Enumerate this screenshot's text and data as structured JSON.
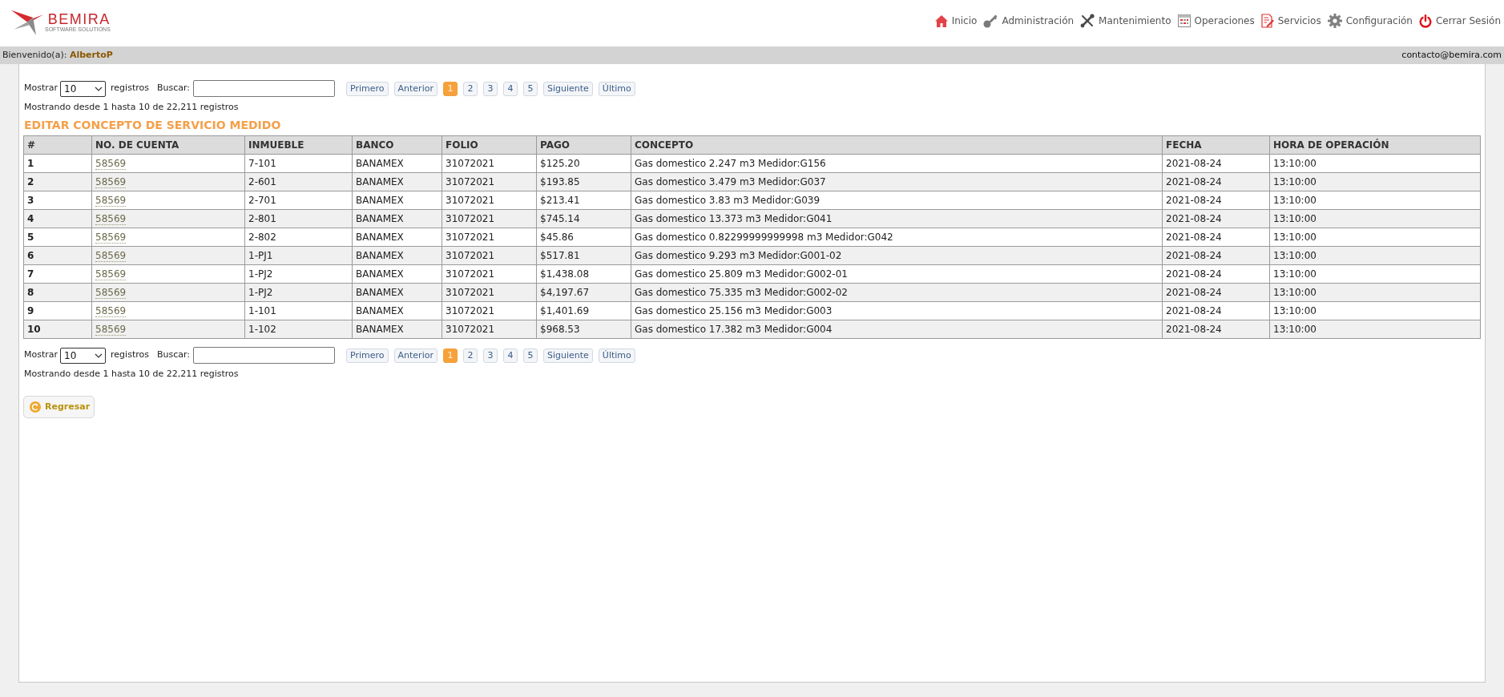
{
  "header": {
    "logo": {
      "brand": "BEMIRA",
      "tagline": "SOFTWARE SOLUTIONS"
    },
    "nav": [
      "Inicio",
      "Administración",
      "Mantenimiento",
      "Operaciones",
      "Servicios",
      "Configuración",
      "Cerrar Sesión"
    ]
  },
  "user_bar": {
    "greeting": "Bienvenido(a):",
    "user": "AlbertoP",
    "email": "contacto@bemira.com"
  },
  "pager_top": {
    "show_label": "Mostrar",
    "page_size": "10",
    "records_label": "registros",
    "search_label": "Buscar:",
    "first": "Primero",
    "prev": "Anterior",
    "pages": [
      {
        "label": "1",
        "selected": true
      },
      {
        "label": "2",
        "selected": false
      },
      {
        "label": "3",
        "selected": false
      },
      {
        "label": "4",
        "selected": false
      },
      {
        "label": "5",
        "selected": false
      }
    ],
    "next": "Siguiente",
    "last": "Último",
    "summary": "Mostrando desde 1 hasta 10 de 22,211 registros"
  },
  "title": "EDITAR CONCEPTO DE SERVICIO MEDIDO",
  "table": {
    "columns": [
      "#",
      "NO. DE CUENTA",
      "INMUEBLE",
      "BANCO",
      "FOLIO",
      "PAGO",
      "CONCEPTO",
      "FECHA",
      "HORA DE OPERACIÓN"
    ],
    "rows": [
      [
        "1",
        "58569",
        "7-101",
        "BANAMEX",
        "31072021",
        "$125.20",
        "Gas domestico 2.247 m3 Medidor:G156",
        "2021-08-24",
        "13:10:00"
      ],
      [
        "2",
        "58569",
        "2-601",
        "BANAMEX",
        "31072021",
        "$193.85",
        "Gas domestico 3.479 m3 Medidor:G037",
        "2021-08-24",
        "13:10:00"
      ],
      [
        "3",
        "58569",
        "2-701",
        "BANAMEX",
        "31072021",
        "$213.41",
        "Gas domestico 3.83 m3 Medidor:G039",
        "2021-08-24",
        "13:10:00"
      ],
      [
        "4",
        "58569",
        "2-801",
        "BANAMEX",
        "31072021",
        "$745.14",
        "Gas domestico 13.373 m3 Medidor:G041",
        "2021-08-24",
        "13:10:00"
      ],
      [
        "5",
        "58569",
        "2-802",
        "BANAMEX",
        "31072021",
        "$45.86",
        "Gas domestico 0.82299999999998 m3 Medidor:G042",
        "2021-08-24",
        "13:10:00"
      ],
      [
        "6",
        "58569",
        "1-PJ1",
        "BANAMEX",
        "31072021",
        "$517.81",
        "Gas domestico 9.293 m3 Medidor:G001-02",
        "2021-08-24",
        "13:10:00"
      ],
      [
        "7",
        "58569",
        "1-PJ2",
        "BANAMEX",
        "31072021",
        "$1,438.08",
        "Gas domestico 25.809 m3 Medidor:G002-01",
        "2021-08-24",
        "13:10:00"
      ],
      [
        "8",
        "58569",
        "1-PJ2",
        "BANAMEX",
        "31072021",
        "$4,197.67",
        "Gas domestico 75.335 m3 Medidor:G002-02",
        "2021-08-24",
        "13:10:00"
      ],
      [
        "9",
        "58569",
        "1-101",
        "BANAMEX",
        "31072021",
        "$1,401.69",
        "Gas domestico 25.156 m3 Medidor:G003",
        "2021-08-24",
        "13:10:00"
      ],
      [
        "10",
        "58569",
        "1-102",
        "BANAMEX",
        "31072021",
        "$968.53",
        "Gas domestico 17.382 m3 Medidor:G004",
        "2021-08-24",
        "13:10:00"
      ]
    ]
  },
  "pager_bottom": {
    "show_label": "Mostrar",
    "page_size": "10",
    "records_label": "registros",
    "search_label": "Buscar:",
    "first": "Primero",
    "prev": "Anterior",
    "pages": [
      {
        "label": "1",
        "selected": true
      },
      {
        "label": "2",
        "selected": false
      },
      {
        "label": "3",
        "selected": false
      },
      {
        "label": "4",
        "selected": false
      },
      {
        "label": "5",
        "selected": false
      }
    ],
    "next": "Siguiente",
    "last": "Último",
    "summary": "Mostrando desde 1 hasta 10 de 22,211 registros"
  },
  "back_button": "Regresar"
}
